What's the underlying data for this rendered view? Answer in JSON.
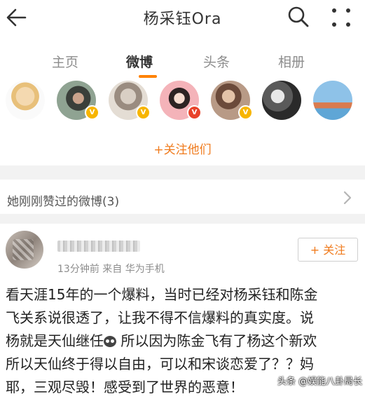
{
  "header": {
    "title": "杨采钰Ora"
  },
  "tabs": [
    {
      "label": "主页"
    },
    {
      "label": "微博"
    },
    {
      "label": "头条"
    },
    {
      "label": "相册"
    }
  ],
  "follow_all": "+关注他们",
  "section": {
    "title": "她刚刚赞过的微博(3)"
  },
  "post": {
    "meta": "13分钟前  来自 华为手机",
    "follow_label": "+ 关注",
    "lines": [
      "看天涯15年的一个爆料，当时已经对杨采钰和陈金",
      "飞关系说很透了，让我不得不信爆料的真实度。说",
      "杨就是天仙继任",
      " 所以因为陈金飞有了杨这个新欢",
      "所以天仙终于得以自由，可以和宋谈恋爱了？？妈",
      "耶，三观尽毁！感受到了世界的恶意！"
    ]
  },
  "watermark": "头条 @娱能八卦局长",
  "colors": {
    "accent": "#ff8200",
    "link": "#f07b1d",
    "badge_gold": "#f7b500",
    "badge_red": "#e8432b"
  }
}
